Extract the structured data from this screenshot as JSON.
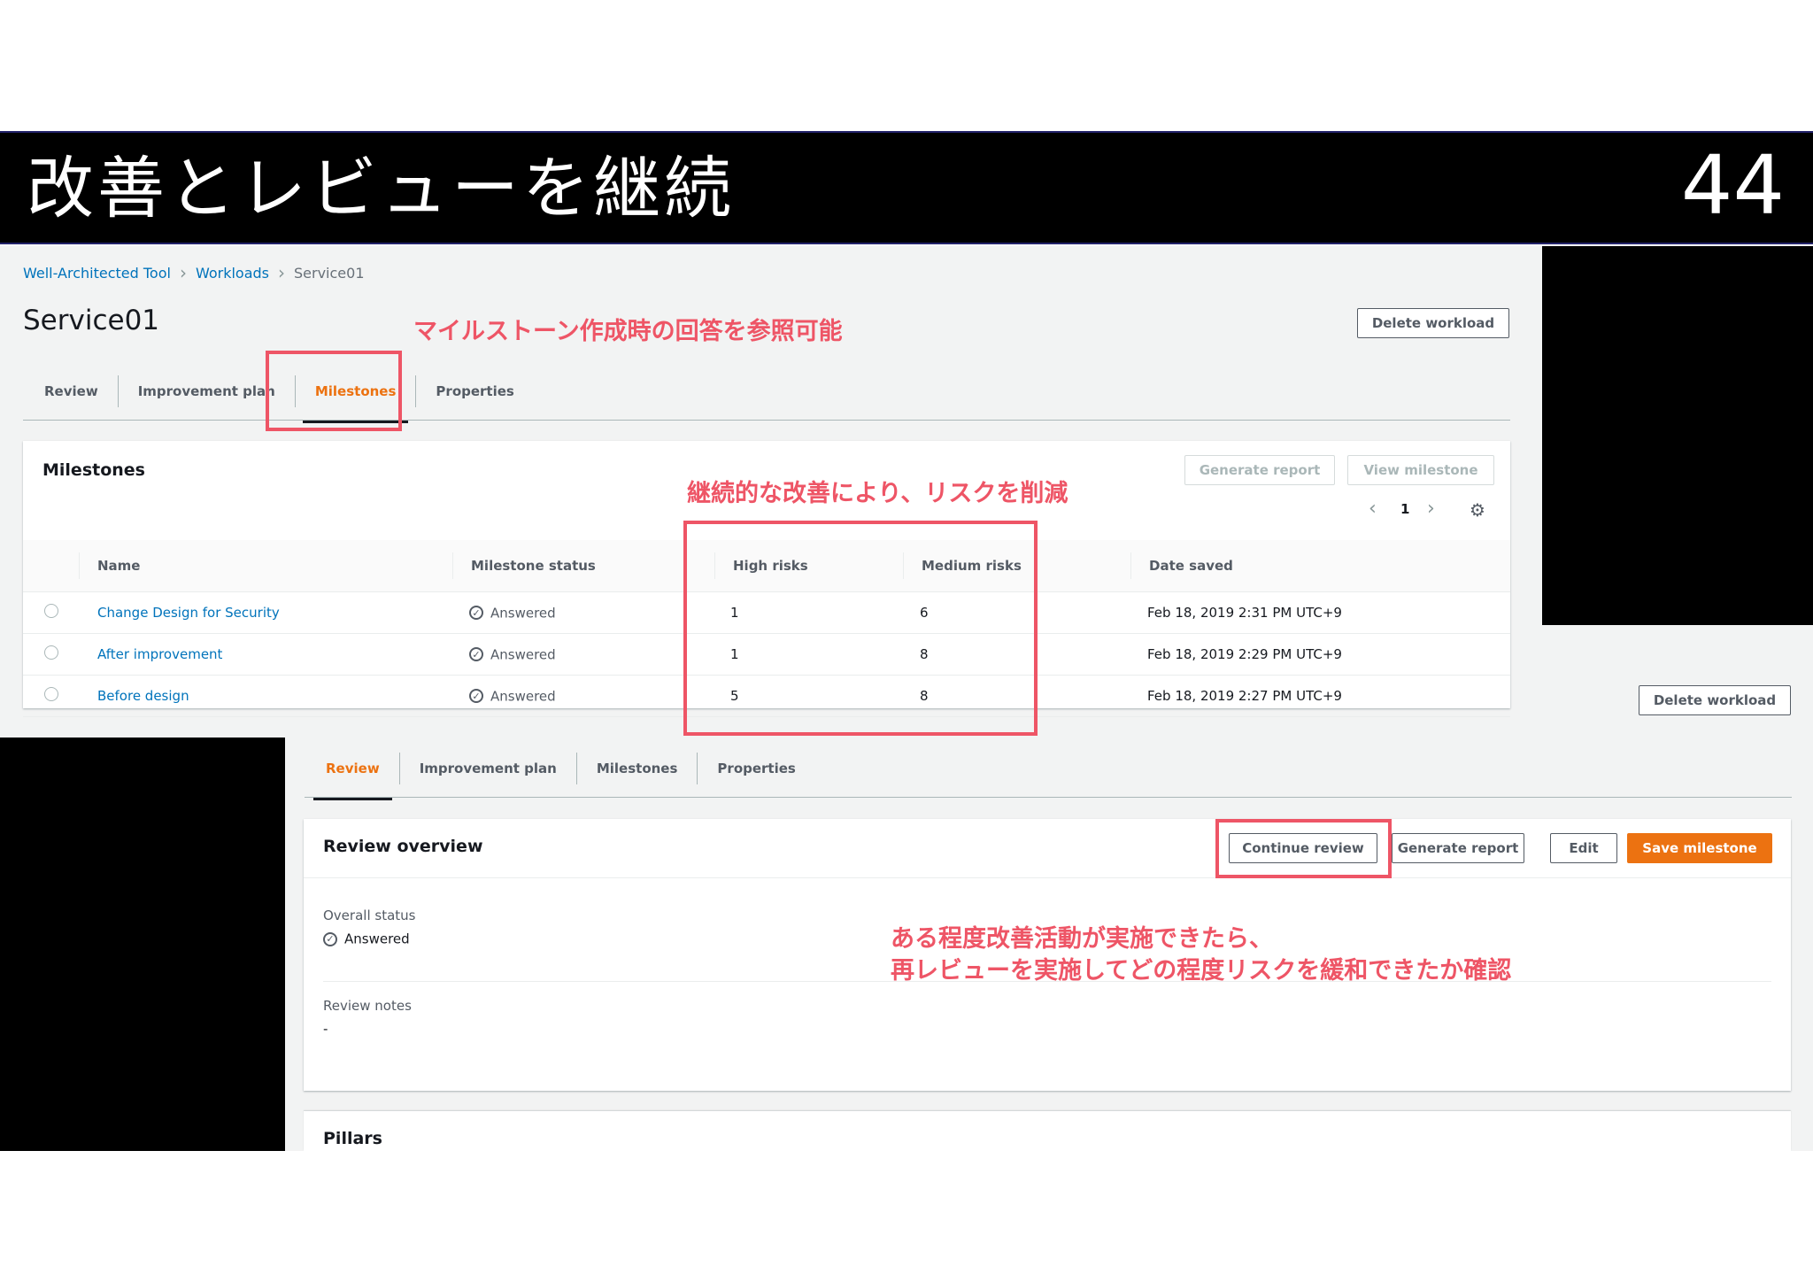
{
  "slide": {
    "title": "改善とレビューを継続",
    "page_number": "44"
  },
  "top_screen": {
    "breadcrumb": [
      "Well-Architected Tool",
      "Workloads",
      "Service01"
    ],
    "page_title": "Service01",
    "delete_button": "Delete workload",
    "tabs": [
      "Review",
      "Improvement plan",
      "Milestones",
      "Properties"
    ],
    "active_tab": "Milestones",
    "milestones_card": {
      "title": "Milestones",
      "generate_report": "Generate report",
      "view_milestone": "View milestone",
      "page": "1",
      "columns": [
        "Name",
        "Milestone status",
        "High risks",
        "Medium risks",
        "Date saved"
      ],
      "rows": [
        {
          "name": "Change Design for Security",
          "status": "Answered",
          "high": "1",
          "medium": "6",
          "date": "Feb 18, 2019 2:31 PM UTC+9"
        },
        {
          "name": "After improvement",
          "status": "Answered",
          "high": "1",
          "medium": "8",
          "date": "Feb 18, 2019 2:29 PM UTC+9"
        },
        {
          "name": "Before design",
          "status": "Answered",
          "high": "5",
          "medium": "8",
          "date": "Feb 18, 2019 2:27 PM UTC+9"
        }
      ]
    }
  },
  "bottom_screen": {
    "delete_button": "Delete workload",
    "tabs": [
      "Review",
      "Improvement plan",
      "Milestones",
      "Properties"
    ],
    "active_tab": "Review",
    "review_card": {
      "title": "Review overview",
      "continue_review": "Continue review",
      "generate_report": "Generate report",
      "edit": "Edit",
      "save_milestone": "Save milestone",
      "overall_status_label": "Overall status",
      "overall_status_value": "Answered",
      "review_notes_label": "Review notes",
      "review_notes_value": "-"
    },
    "pillars_title": "Pillars"
  },
  "annotations": {
    "milestones_note": "マイルストーン作成時の回答を参照可能",
    "risk_note": "継続的な改善により、リスクを削減",
    "review_note_line1": "ある程度改善活動が実施できたら、",
    "review_note_line2": "再レビューを実施してどの程度リスクを緩和できたか確認"
  },
  "colors": {
    "accent": "#ec7211",
    "annotation": "#ee5566",
    "link": "#0073bb"
  }
}
